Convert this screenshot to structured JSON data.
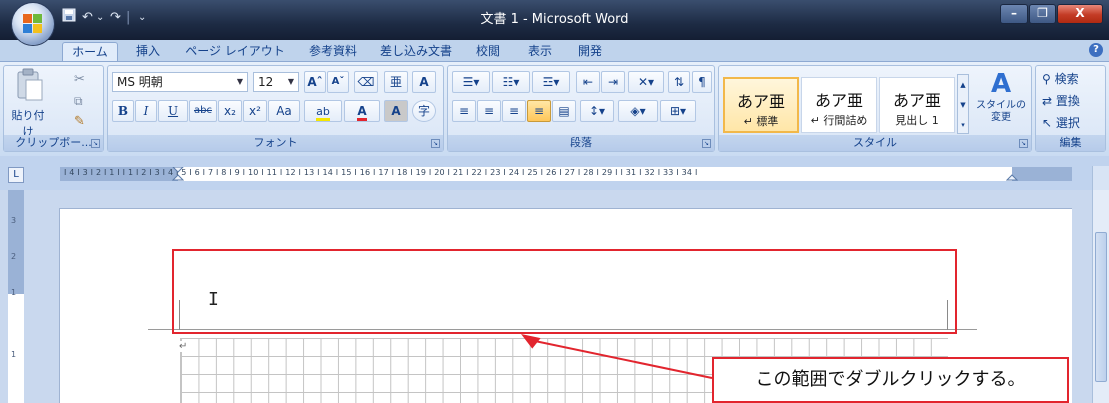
{
  "window": {
    "title": "文書 1 - Microsoft Word",
    "minimize": "–",
    "maximize": "❐",
    "close": "X"
  },
  "quick_access": {
    "save_icon": "floppy-icon",
    "undo_icon": "↶",
    "redo_icon": "↷",
    "customize": "⌄",
    "separator": "|"
  },
  "tabs": [
    "ホーム",
    "挿入",
    "ページ レイアウト",
    "参考資料",
    "差し込み文書",
    "校閲",
    "表示",
    "開発"
  ],
  "active_tab": 0,
  "help": "?",
  "clipboard": {
    "paste": "貼り付け",
    "label": "クリップボー..."
  },
  "font": {
    "name": "MS 明朝",
    "size": "12",
    "grow": "Aˆ",
    "shrink": "Aˇ",
    "bold": "B",
    "italic": "I",
    "underline": "U",
    "strike": "abc",
    "subscript": "x₂",
    "superscript": "x²",
    "case": "Aa",
    "highlight": "ab",
    "font_color": "A",
    "char_shading": "A",
    "enclose": "字",
    "label": "フォント"
  },
  "paragraph": {
    "label": "段落"
  },
  "styles": {
    "items": [
      {
        "sample": "あア亜",
        "name": "↵ 標準"
      },
      {
        "sample": "あア亜",
        "name": "↵ 行間詰め"
      },
      {
        "sample": "あア亜",
        "name": "見出し 1"
      }
    ],
    "change_styles": "スタイルの変更",
    "label": "スタイル"
  },
  "editing": {
    "find": "検索",
    "replace": "置換",
    "select": "選択",
    "label": "編集"
  },
  "ruler": {
    "toggle": "L",
    "scale": "I 4 I 3 I 2 I 1 I    I 1 I 2 I 3 I 4 I 5 I 6 I 7 I 8 I 9 I 10 I 11 I 12 I 13 I 14 I 15 I 16 I 17 I 18 I 19 I 20 I 21 I 22 I 23 I 24 I 25 I 26 I 27 I 28 I 29 I    I 31 I 32 I 33 I 34 I",
    "vertical": [
      "3",
      "2",
      "1",
      "1"
    ]
  },
  "document": {
    "para_mark": "↵",
    "cursor": "I"
  },
  "annotation": {
    "callout": "この範囲でダブルクリックする。",
    "color": "#e2252e"
  }
}
